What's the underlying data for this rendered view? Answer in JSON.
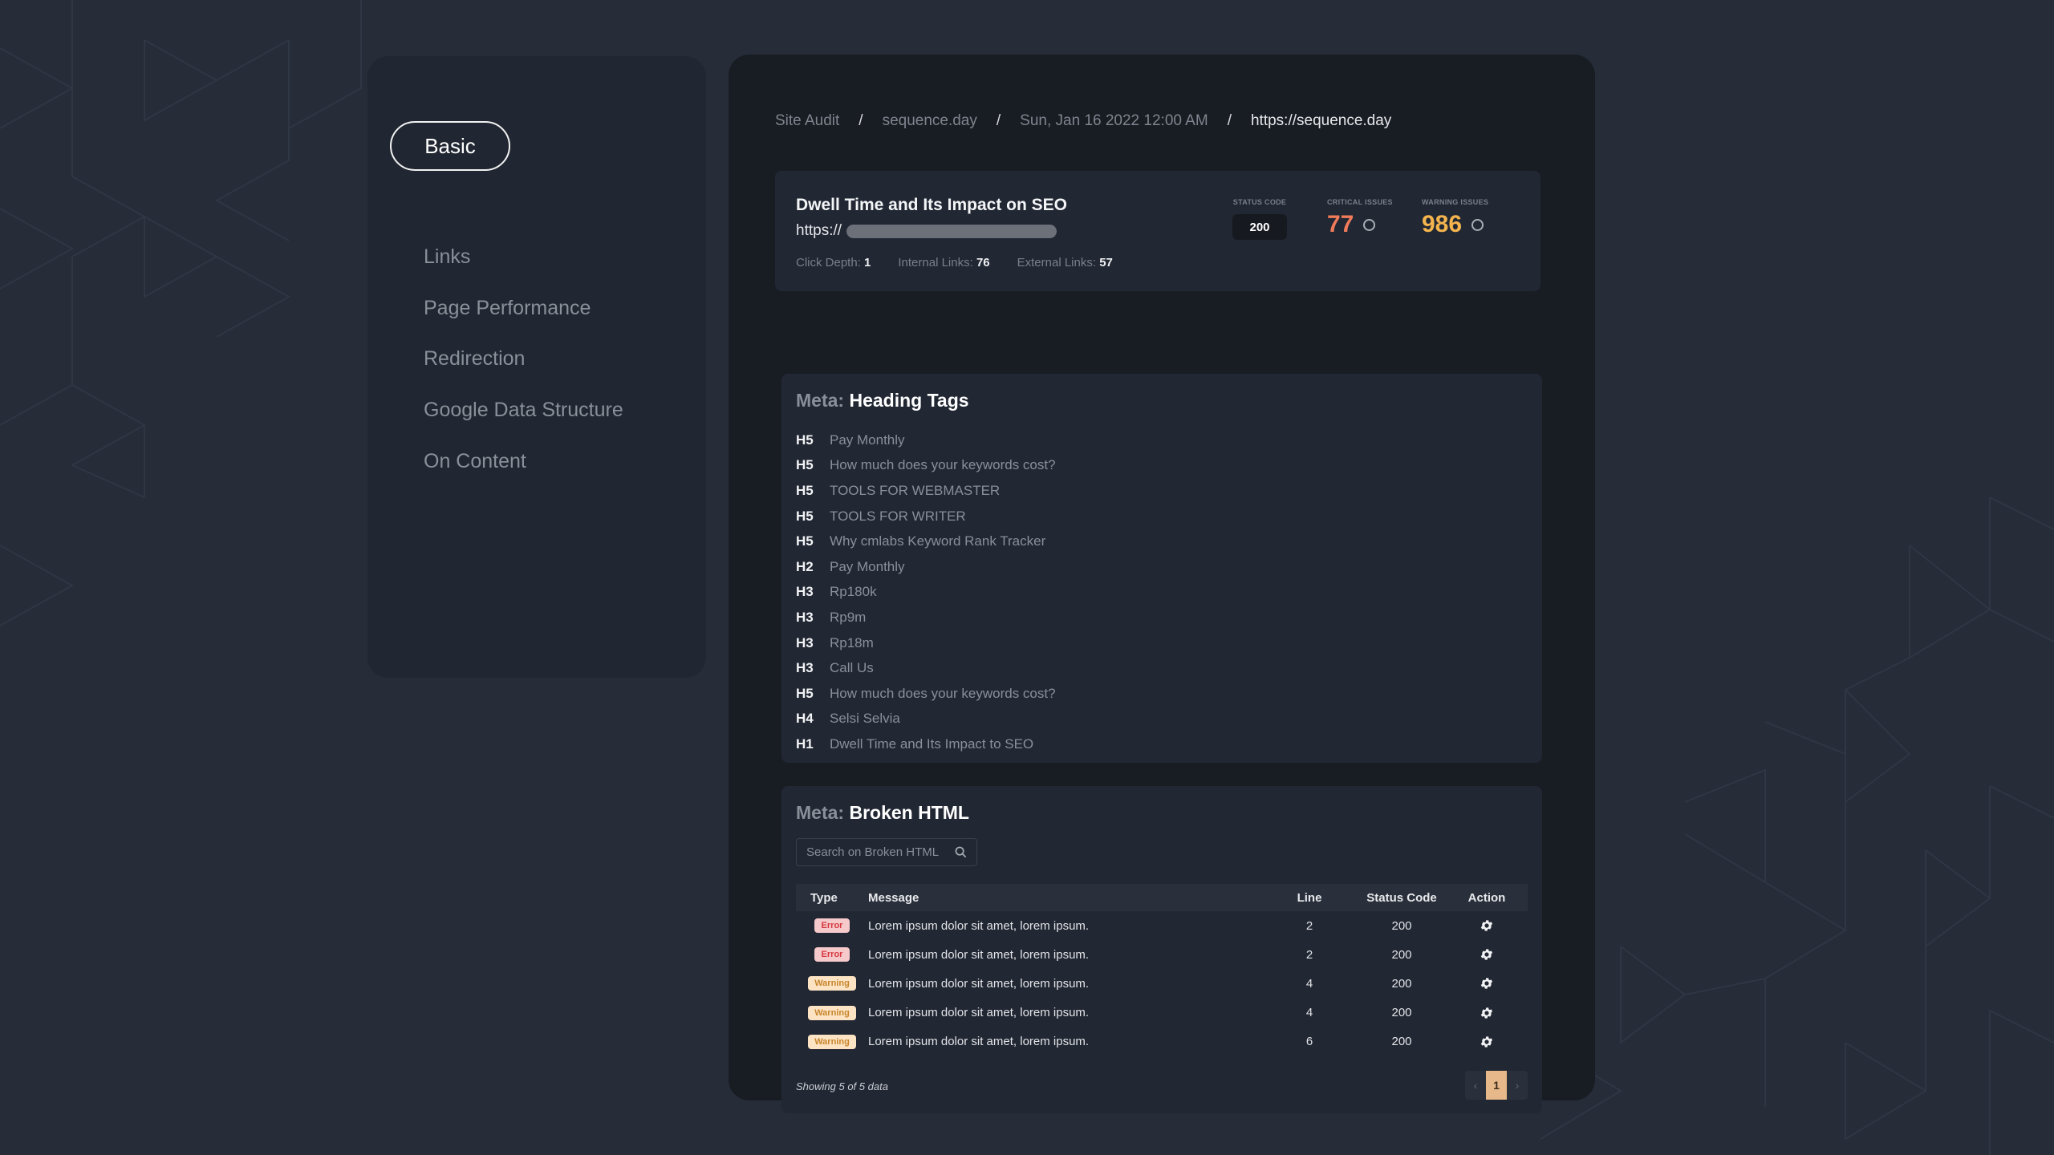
{
  "sidebar": {
    "items": [
      {
        "label": "Basic",
        "active": true
      },
      {
        "label": "Links"
      },
      {
        "label": "Page Performance"
      },
      {
        "label": "Redirection"
      },
      {
        "label": "Google Data Structure"
      },
      {
        "label": "On Content"
      }
    ]
  },
  "breadcrumb": [
    "Site Audit",
    "sequence.day",
    "Sun, Jan 16 2022 12:00 AM",
    "https://sequence.day"
  ],
  "summary": {
    "title": "Dwell Time and Its Impact on SEO",
    "url_prefix": "https://",
    "click_depth_label": "Click Depth:",
    "click_depth": "1",
    "internal_links_label": "Internal Links:",
    "internal_links": "76",
    "external_links_label": "External Links:",
    "external_links": "57",
    "status_code_label": "STATUS CODE",
    "status_code": "200",
    "critical_label": "CRITICAL ISSUES",
    "critical": "77",
    "warning_label": "WARNING ISSUES",
    "warning": "986",
    "colors": {
      "critical": "#f07b5a",
      "warning": "#f4b44e"
    }
  },
  "headings": {
    "prefix": "Meta:",
    "title": "Heading Tags",
    "rows": [
      {
        "tag": "H5",
        "text": "Pay Monthly"
      },
      {
        "tag": "H5",
        "text": "How much does your keywords cost?"
      },
      {
        "tag": "H5",
        "text": "TOOLS FOR WEBMASTER"
      },
      {
        "tag": "H5",
        "text": "TOOLS FOR WRITER"
      },
      {
        "tag": "H5",
        "text": "Why cmlabs Keyword Rank Tracker"
      },
      {
        "tag": "H2",
        "text": "Pay Monthly"
      },
      {
        "tag": "H3",
        "text": "Rp180k"
      },
      {
        "tag": "H3",
        "text": "Rp9m"
      },
      {
        "tag": "H3",
        "text": "Rp18m"
      },
      {
        "tag": "H3",
        "text": "Call Us"
      },
      {
        "tag": "H5",
        "text": "How much does your keywords cost?"
      },
      {
        "tag": "H4",
        "text": "Selsi Selvia"
      },
      {
        "tag": "H1",
        "text": "Dwell Time and Its Impact to SEO"
      }
    ]
  },
  "broken": {
    "prefix": "Meta:",
    "title": "Broken HTML",
    "search_placeholder": "Search on Broken HTML",
    "columns": [
      "Type",
      "Message",
      "Line",
      "Status Code",
      "Action"
    ],
    "rows": [
      {
        "type": "Error",
        "message": "Lorem ipsum dolor sit amet, lorem ipsum.",
        "line": "2",
        "status": "200"
      },
      {
        "type": "Error",
        "message": "Lorem ipsum dolor sit amet, lorem ipsum.",
        "line": "2",
        "status": "200"
      },
      {
        "type": "Warning",
        "message": "Lorem ipsum dolor sit amet, lorem ipsum.",
        "line": "4",
        "status": "200"
      },
      {
        "type": "Warning",
        "message": "Lorem ipsum dolor sit amet, lorem ipsum.",
        "line": "4",
        "status": "200"
      },
      {
        "type": "Warning",
        "message": "Lorem ipsum dolor sit amet, lorem ipsum.",
        "line": "6",
        "status": "200"
      }
    ],
    "footer": "Showing 5 of 5 data",
    "pager": {
      "prev": "‹",
      "current": "1",
      "next": "›"
    }
  }
}
